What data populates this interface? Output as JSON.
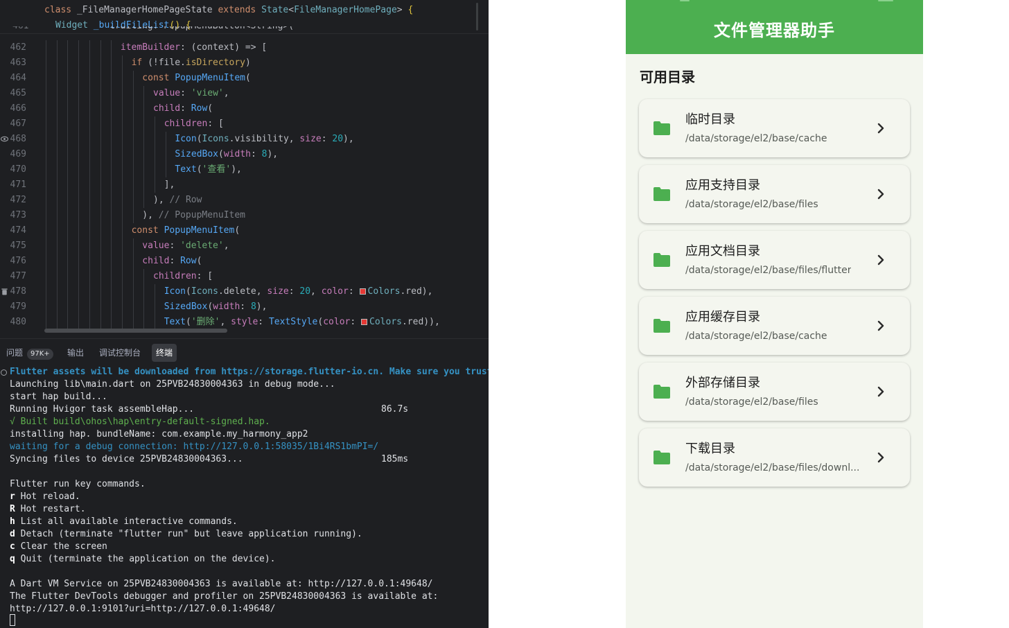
{
  "ide": {
    "sticky": {
      "line1": {
        "kw": "class",
        "name": "_FileManagerHomePageState",
        "kw2": "extends",
        "type": "State",
        "generic": "FileManagerHomePage"
      },
      "line2": {
        "type": "Widget",
        "fn": "_buildFileList",
        "rest": "() {"
      }
    },
    "partial_line": {
      "num": "461",
      "text": "trailing: PopupMenuButton<String>("
    },
    "code_lines": [
      {
        "num": "462",
        "text": "itemBuilder: (context) => ["
      },
      {
        "num": "463",
        "text": "if (!file.isDirectory)"
      },
      {
        "num": "464",
        "text": "const PopupMenuItem("
      },
      {
        "num": "465",
        "text": "value: 'view',"
      },
      {
        "num": "466",
        "text": "child: Row("
      },
      {
        "num": "467",
        "text": "children: ["
      },
      {
        "num": "468",
        "text": "Icon(Icons.visibility, size: 20),"
      },
      {
        "num": "469",
        "text": "SizedBox(width: 8),"
      },
      {
        "num": "470",
        "text": "Text('查看'),"
      },
      {
        "num": "471",
        "text": "],"
      },
      {
        "num": "472",
        "text": "), // Row"
      },
      {
        "num": "473",
        "text": "), // PopupMenuItem"
      },
      {
        "num": "474",
        "text": "const PopupMenuItem("
      },
      {
        "num": "475",
        "text": "value: 'delete',"
      },
      {
        "num": "476",
        "text": "child: Row("
      },
      {
        "num": "477",
        "text": "children: ["
      },
      {
        "num": "478",
        "text": "Icon(Icons.delete, size: 20, color: Colors.red),"
      },
      {
        "num": "479",
        "text": "SizedBox(width: 8),"
      },
      {
        "num": "480",
        "text": "Text('删除', style: TextStyle(color: Colors.red)),"
      }
    ],
    "tool_tabs": {
      "problems": "问题",
      "problems_count": "97K+",
      "output": "输出",
      "debug_console": "调试控制台",
      "terminal": "终端"
    },
    "terminal": {
      "lines": [
        "Flutter assets will be downloaded from https://storage.flutter-io.cn. Make sure you trust this source!",
        "Launching lib\\main.dart on 25PVB24830004363 in debug mode...",
        "start hap build...",
        "Running Hvigor task assembleHap...",
        "√ Built build\\ohos\\hap\\entry-default-signed.hap.",
        "installing hap. bundleName: com.example.my_harmony_app2",
        "waiting for a debug connection: http://127.0.0.1:58035/1Bi4RS1bmPI=/",
        "Syncing files to device 25PVB24830004363...",
        "",
        "Flutter run key commands.",
        "Hot reload.",
        "Hot restart.",
        "List all available interactive commands.",
        "Detach (terminate \"flutter run\" but leave application running).",
        "Clear the screen",
        "Quit (terminate the application on the device).",
        "",
        "A Dart VM Service on 25PVB24830004363 is available at: http://127.0.0.1:49648/",
        "The Flutter DevTools debugger and profiler on 25PVB24830004363 is available at:",
        "http://127.0.0.1:9101?uri=http://127.0.0.1:49648/"
      ],
      "keys": [
        "r",
        "R",
        "h",
        "d",
        "c",
        "q"
      ],
      "timing_hvigor": "86.7s",
      "timing_sync": "185ms"
    },
    "colors": {
      "editor_bg": "#1e1f22",
      "keyword": "#cf8e6d",
      "type": "#6fafbd",
      "string": "#6aab73",
      "number": "#2aacb8",
      "red_swatch": "#e53935"
    }
  },
  "phone": {
    "title": "文件管理器助手",
    "section_title": "可用目录",
    "colors": {
      "appbar": "#4caf50",
      "folder": "#4caf50",
      "background": "#f3f6ee"
    },
    "directories": [
      {
        "title": "临时目录",
        "path": "/data/storage/el2/base/cache",
        "icon": "folder-icon"
      },
      {
        "title": "应用支持目录",
        "path": "/data/storage/el2/base/files",
        "icon": "folder-icon"
      },
      {
        "title": "应用文档目录",
        "path": "/data/storage/el2/base/files/flutter",
        "icon": "folder-icon"
      },
      {
        "title": "应用缓存目录",
        "path": "/data/storage/el2/base/cache",
        "icon": "folder-icon"
      },
      {
        "title": "外部存储目录",
        "path": "/data/storage/el2/base/files",
        "icon": "folder-icon"
      },
      {
        "title": "下载目录",
        "path": "/data/storage/el2/base/files/downl...",
        "icon": "folder-icon"
      }
    ]
  }
}
